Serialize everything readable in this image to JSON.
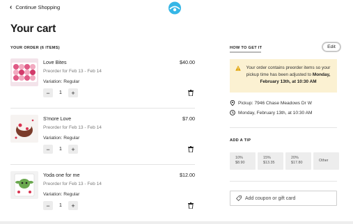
{
  "header": {
    "back_label": "Continue Shopping"
  },
  "cart": {
    "title": "Your cart",
    "order_heading": "YOUR ORDER (6 ITEMS)",
    "items": [
      {
        "name": "Love Bites",
        "price": "$40.00",
        "preorder": "Preorder for Feb 13 - Feb 14",
        "variation": "Variation: Regular",
        "qty": "1"
      },
      {
        "name": "S'more Love",
        "price": "$7.00",
        "preorder": "Preorder for Feb 13 - Feb 14",
        "variation": "Variation: Regular",
        "qty": "1"
      },
      {
        "name": "Yoda one for me",
        "price": "$12.00",
        "preorder": "Preorder for Feb 13 - Feb 14",
        "variation": "Variation: Regular",
        "qty": "1"
      }
    ],
    "minus_symbol": "−",
    "plus_symbol": "+"
  },
  "fulfillment": {
    "heading": "HOW TO GET IT",
    "edit_label": "Edit",
    "notice_text": "Your order contains preorder items so your pickup time has been adjusted to",
    "notice_time": "Monday, February 13th, at 10:30 AM",
    "pickup_text": "Pickup: 7946 Chase Meadows Dr W",
    "time_text": "Monday, February 13th, at 10:30 AM",
    "colors": {
      "notice_bg": "#fbf1d2",
      "warn_icon": "#e0a100"
    }
  },
  "tip": {
    "heading": "ADD A TIP",
    "options": [
      {
        "percent": "10%",
        "amount": "$8.90"
      },
      {
        "percent": "15%",
        "amount": "$13.35"
      },
      {
        "percent": "20%",
        "amount": "$17.80"
      },
      {
        "percent": "Other",
        "amount": ""
      }
    ]
  },
  "coupon": {
    "label": "Add coupon or gift card"
  },
  "icons": {
    "back": "chevron-left-icon",
    "logo": "store-logo",
    "trash": "trash-icon",
    "warning": "warning-icon",
    "location": "location-pin-icon",
    "clock": "clock-icon",
    "tag": "tag-icon"
  }
}
